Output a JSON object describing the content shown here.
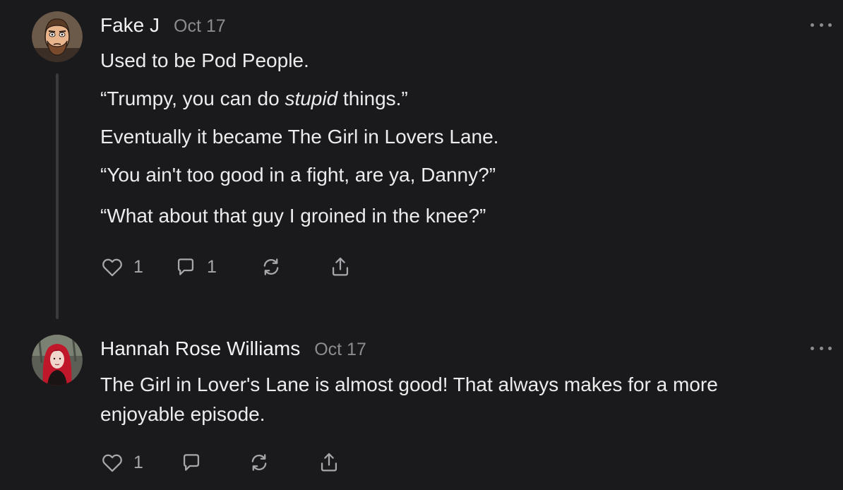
{
  "comments": [
    {
      "author": "Fake J",
      "date": "Oct 17",
      "avatar": "cartoon-bearded-man-avatar",
      "paragraphs": [
        {
          "text": "Used to be Pod People."
        },
        {
          "before": "“Trumpy, you can do ",
          "emphasis": "stupid",
          "after": " things.”"
        },
        {
          "text": "Eventually it became The Girl in Lovers Lane."
        },
        {
          "text": "“You ain't too good in a fight, are ya, Danny?”"
        },
        {
          "text": "“What about that guy I groined in the knee?”"
        }
      ],
      "actions": {
        "like_count": "1",
        "reply_count": "1"
      }
    },
    {
      "author": "Hannah Rose Williams",
      "date": "Oct 17",
      "avatar": "red-haired-woman-photo-avatar",
      "paragraphs": [
        {
          "text": "The Girl in Lover's Lane is almost good! That always makes for a more enjoyable episode."
        }
      ],
      "actions": {
        "like_count": "1"
      }
    }
  ],
  "icons": {
    "like": "heart-icon",
    "reply": "speech-bubble-icon",
    "restack": "refresh-arrows-icon",
    "share": "share-upload-icon",
    "more": "more-dots-icon"
  },
  "colors": {
    "background": "#1a1a1c",
    "text": "#ececed",
    "muted": "#8c8c90",
    "icon": "#a8a8ac",
    "thread_line": "#3a3a3d"
  }
}
